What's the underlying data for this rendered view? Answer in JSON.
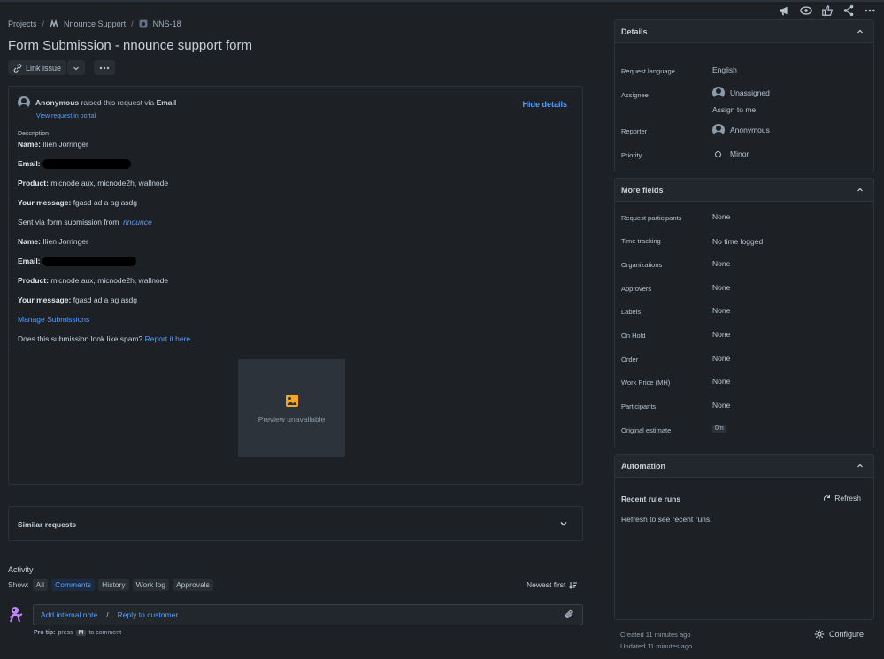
{
  "breadcrumb": {
    "projects": "Projects",
    "project": "Nnounce Support",
    "issue_key": "NNS-18"
  },
  "page_title": "Form Submission - nnounce support form",
  "actions": {
    "link_issue": "Link issue"
  },
  "request": {
    "requester": "Anonymous",
    "raised_text": "raised this request via",
    "channel": "Email",
    "hide_details": "Hide details",
    "view_portal": "View request in portal",
    "description_label": "Description",
    "name_label": "Name:",
    "name": "Ilien Jorringer",
    "email_label": "Email:",
    "product_label": "Product:",
    "product": "micnode aux, micnode2h, wallnode",
    "message_label": "Your message:",
    "message": "fgasd ad a ag asdg",
    "sent_via": "Sent via form submission from",
    "sent_link": "nnounce",
    "manage": "Manage Submissions",
    "spam_question": "Does this submission look like spam?",
    "spam_link": "Report it here.",
    "preview": "Preview unavailable"
  },
  "similar": "Similar requests",
  "activity": {
    "title": "Activity",
    "show": "Show:",
    "filters": [
      "All",
      "Comments",
      "History",
      "Work log",
      "Approvals"
    ],
    "active_filter": "Comments",
    "sort": "Newest first",
    "internal_note": "Add internal note",
    "slash": "/",
    "reply": "Reply to customer",
    "protip_pre": "Pro tip:",
    "protip_press": "press",
    "protip_key": "M",
    "protip_post": "to comment"
  },
  "details": {
    "title": "Details",
    "rows": {
      "language_label": "Request language",
      "language": "English",
      "assignee_label": "Assignee",
      "assignee": "Unassigned",
      "assign_me": "Assign to me",
      "reporter_label": "Reporter",
      "reporter": "Anonymous",
      "priority_label": "Priority",
      "priority": "Minor"
    }
  },
  "more_fields": {
    "title": "More fields",
    "rows": [
      {
        "label": "Request participants",
        "value": "None"
      },
      {
        "label": "Time tracking",
        "value": "No time logged"
      },
      {
        "label": "Organizations",
        "value": "None"
      },
      {
        "label": "Approvers",
        "value": "None"
      },
      {
        "label": "Labels",
        "value": "None"
      },
      {
        "label": "On Hold",
        "value": "None"
      },
      {
        "label": "Order",
        "value": "None"
      },
      {
        "label": "Work Price (MH)",
        "value": "None"
      },
      {
        "label": "Participants",
        "value": "None"
      },
      {
        "label": "Original estimate",
        "value": "0m"
      }
    ]
  },
  "automation": {
    "title": "Automation",
    "recent": "Recent rule runs",
    "refresh": "Refresh",
    "hint": "Refresh to see recent runs."
  },
  "meta": {
    "created": "Created 11 minutes ago",
    "updated": "Updated 11 minutes ago",
    "configure": "Configure"
  },
  "colors": {
    "background": "#1d2125",
    "link": "#579dff",
    "text": "#b6c2cf",
    "preview_icon": "#f5a623"
  }
}
